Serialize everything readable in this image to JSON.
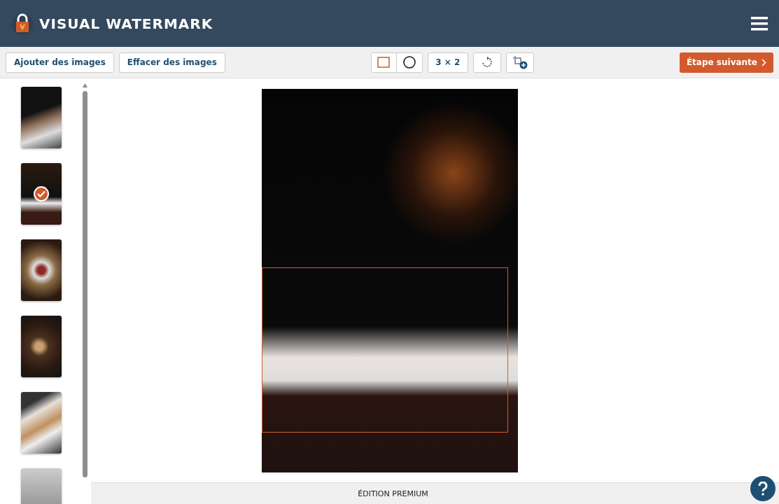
{
  "header": {
    "title": "VISUAL WATERMARK"
  },
  "toolbar": {
    "left_buttons": [
      "Ajouter des images",
      "Effacer des images"
    ],
    "shapes": [
      {
        "kind": "rectangle",
        "selected": true
      },
      {
        "kind": "circle",
        "selected": false
      }
    ],
    "ratio": "3 × 2",
    "next_button": "Étape suivante"
  },
  "thumbnails": [
    {
      "selected": false
    },
    {
      "selected": true
    },
    {
      "selected": false
    },
    {
      "selected": false
    },
    {
      "selected": false
    },
    {
      "selected": false
    }
  ],
  "footer": {
    "edition": "ÉDITION PREMIUM"
  }
}
